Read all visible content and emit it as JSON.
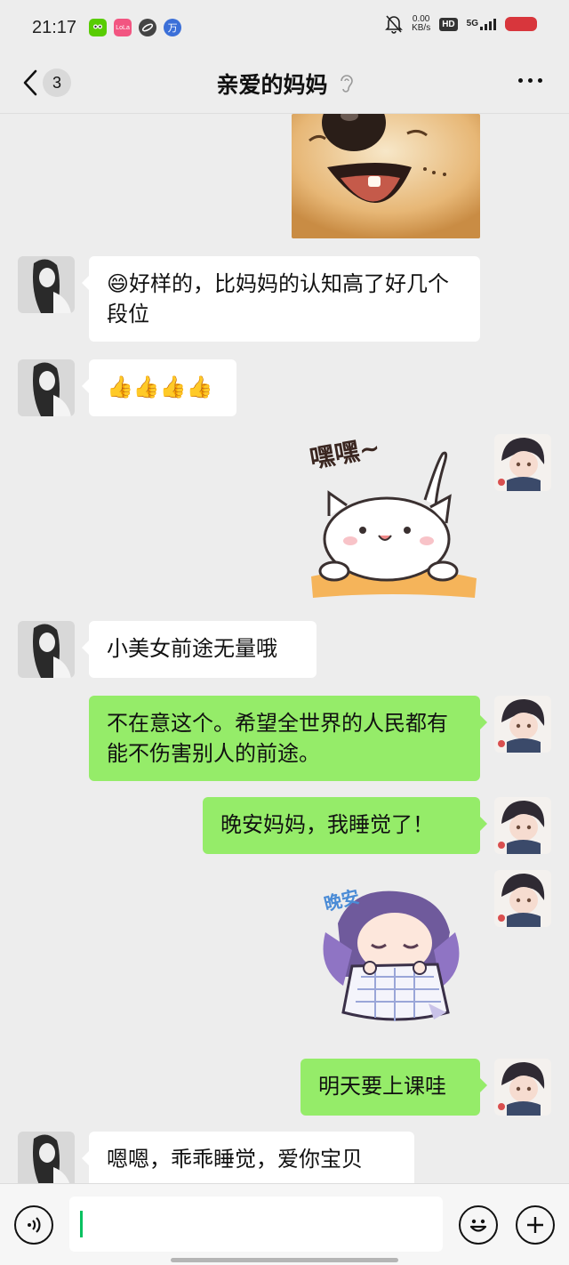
{
  "status_bar": {
    "time": "21:17",
    "net_speed_value": "0.00",
    "net_speed_unit": "KB/s",
    "hd": "HD",
    "network": "5G",
    "app_badge_1": "LoLa",
    "app_badge_2": "万"
  },
  "header": {
    "unread_count": "3",
    "title": "亲爱的妈妈"
  },
  "messages": [
    {
      "type": "sticker",
      "side": "right",
      "sticker": "shiba-dog-laughing"
    },
    {
      "type": "text",
      "side": "left",
      "text": "😄好样的，比妈妈的认知高了好几个段位"
    },
    {
      "type": "text",
      "side": "left",
      "text": "👍👍👍👍"
    },
    {
      "type": "sticker",
      "side": "right",
      "sticker": "white-cat",
      "sticker_text": "嘿嘿~"
    },
    {
      "type": "text",
      "side": "left",
      "text": "小美女前途无量哦"
    },
    {
      "type": "text",
      "side": "right",
      "text": "不在意这个。希望全世界的人民都有能不伤害别人的前途。"
    },
    {
      "type": "text",
      "side": "right",
      "text": "晚安妈妈，我睡觉了！"
    },
    {
      "type": "sticker",
      "side": "right",
      "sticker": "anime-girl-sleeping",
      "sticker_text": "晚安"
    },
    {
      "type": "text",
      "side": "right",
      "text": "明天要上课哇"
    },
    {
      "type": "text",
      "side": "left",
      "text": "嗯嗯，乖乖睡觉，爱你宝贝"
    }
  ],
  "input_bar": {
    "voice_icon": "voice-icon",
    "emoji_icon": "emoji-icon",
    "plus_icon": "plus-icon"
  },
  "colors": {
    "background": "#ededed",
    "outgoing_bubble": "#95ec69",
    "incoming_bubble": "#ffffff",
    "cursor": "#07c160"
  }
}
